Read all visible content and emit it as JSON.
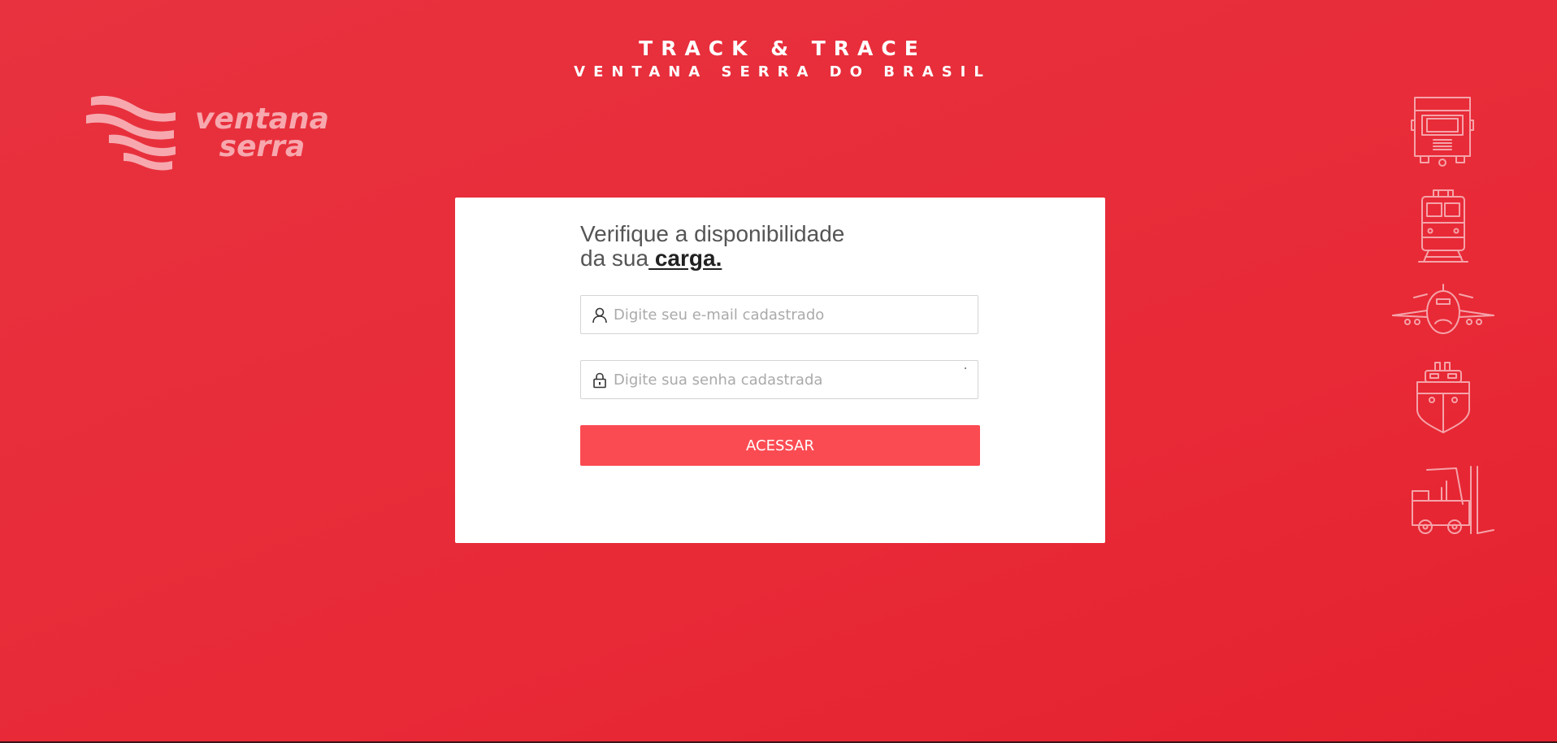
{
  "header": {
    "title": "TRACK & TRACE",
    "subtitle": "VENTANA SERRA DO BRASIL"
  },
  "logo": {
    "line1": "ventana",
    "line2": "serra"
  },
  "form": {
    "heading_line1": "Verifique a disponibilidade",
    "heading_line2_prefix": "da sua",
    "heading_line2_emphasis": " carga.",
    "email_placeholder": "Digite seu e-mail cadastrado",
    "password_placeholder": "Digite sua senha cadastrada",
    "submit_label": "ACESSAR",
    "email_icon": "user-icon",
    "password_icon": "lock-icon"
  },
  "transport_icons": [
    "truck-icon",
    "train-icon",
    "airplane-icon",
    "ship-icon",
    "forklift-icon"
  ],
  "colors": {
    "background": "#e82c39",
    "button": "#fb4b52",
    "icon_stroke": "#f5a3a9"
  }
}
